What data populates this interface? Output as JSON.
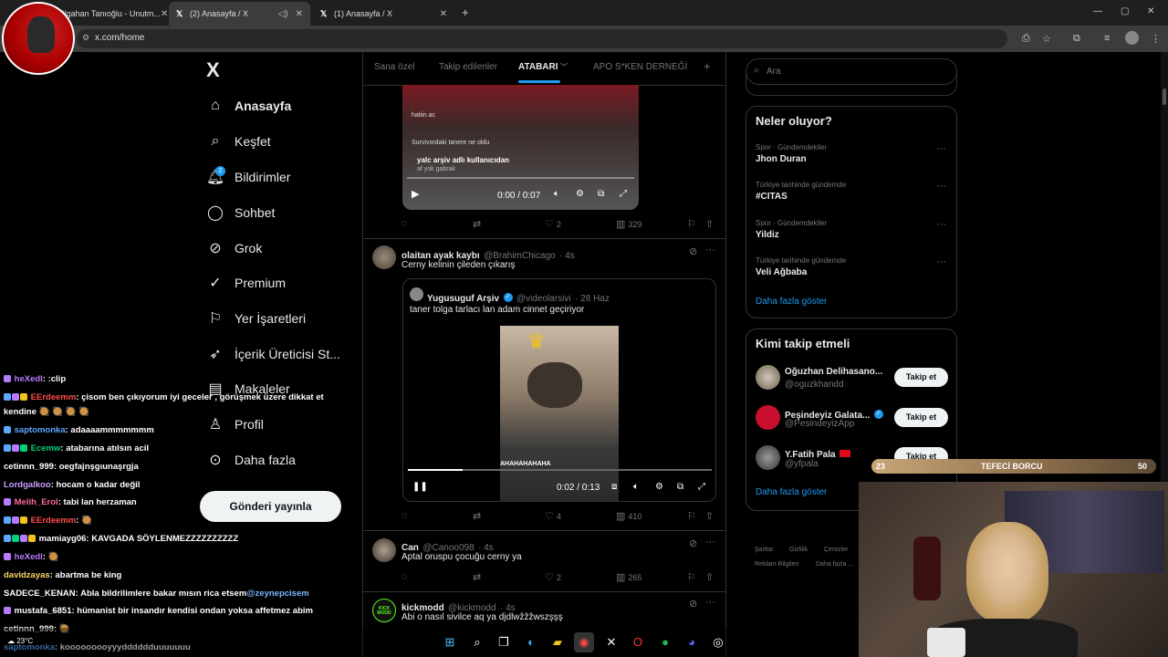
{
  "browser": {
    "tabs": [
      {
        "label": "Ilgahan Tanıoğlu - Unutm..."
      },
      {
        "label": "(2) Anasayfa / X"
      },
      {
        "label": "(1) Anasayfa / X"
      }
    ],
    "new_tab": "+",
    "url": "x.com/home"
  },
  "nav": {
    "logo": "X",
    "items": [
      {
        "label": "Anasayfa",
        "icon": "home-icon"
      },
      {
        "label": "Keşfet",
        "icon": "search-icon"
      },
      {
        "label": "Bildirimler",
        "icon": "bell-icon",
        "badge": "2"
      },
      {
        "label": "Sohbet",
        "icon": "chat-icon"
      },
      {
        "label": "Grok",
        "icon": "grok-icon"
      },
      {
        "label": "Premium",
        "icon": "premium-icon"
      },
      {
        "label": "Yer İşaretleri",
        "icon": "bookmark-icon"
      },
      {
        "label": "İçerik Üreticisi St...",
        "icon": "rocket-icon"
      },
      {
        "label": "Makaleler",
        "icon": "article-icon"
      },
      {
        "label": "Profil",
        "icon": "user-icon"
      },
      {
        "label": "Daha fazla",
        "icon": "more-icon"
      }
    ],
    "post_button": "Gönderi yayınla"
  },
  "main": {
    "tabs": [
      "Sana özel",
      "Takip edilenler",
      "ATABARI",
      "APO S*KEN DERNEĞİ"
    ],
    "add_tab": "+",
    "tweet0": {
      "video_overlay": [
        "hatiin ac",
        "Survivordaki tanere ne oldu",
        "yalc arşiv adlı kullanıcıdan",
        "af yok gabrak"
      ],
      "time": "0:00 / 0:07",
      "likes": "2",
      "views": "329"
    },
    "tweet1": {
      "name": "olaitan ayak kaybı",
      "handle": "@BrahimChicago",
      "time": "· 4s",
      "text": "Cerny kelinin çileden çıkarış",
      "quote": {
        "name": "Yugusuguf Arşiv",
        "handle": "@videolarsivi",
        "time": "· 28 Haz",
        "text": "taner tolga tarlacı lan adam cinnet geçiriyor",
        "video_time": "0:02 / 0:13",
        "video_caption": "AHAHAHAHAHA"
      },
      "likes": "4",
      "views": "410"
    },
    "tweet2": {
      "name": "Can",
      "handle": "@Canoo098",
      "time": "· 4s",
      "text": "Aptal oruspu çocuğu cerny ya",
      "likes": "2",
      "views": "265"
    },
    "tweet3": {
      "name": "kickmodd",
      "handle": "@kickmodd",
      "time": "· 4s",
      "text": "Abi o nasıl sivilce aq ya djdlwẑẑẑwszşşş",
      "avatar_text": "KICK MODD"
    }
  },
  "right": {
    "search_placeholder": "Ara",
    "trends_title": "Neler oluyor?",
    "trends": [
      {
        "category": "Spor · Gündemdekiler",
        "name": "Jhon Duran"
      },
      {
        "category": "Türkiye tarihinde gündemde",
        "name": "#CITAS"
      },
      {
        "category": "Spor · Gündemdekiler",
        "name": "Yildiz"
      },
      {
        "category": "Türkiye tarihinde gündemde",
        "name": "Veli Ağbaba"
      }
    ],
    "show_more": "Daha fazla göster",
    "follow_title": "Kimi takip etmeli",
    "follow": [
      {
        "name": "Oğuzhan Delihasano...",
        "handle": "@oguzkhandd",
        "button": "Takip et"
      },
      {
        "name": "Peşindeyiz Galata...",
        "handle": "@PesindeyizApp",
        "button": "Takip et"
      },
      {
        "name": "Y.Fatih Pala",
        "handle": "@yfpala",
        "button": "Takip et"
      }
    ],
    "follow_more": "Daha fazla göster",
    "footer": [
      "Şartlar",
      "Gizlilik",
      "Çerezler",
      "Reklam Bilgileri",
      "Daha fazla ..."
    ]
  },
  "overlay": {
    "progress_left": "23",
    "progress_title": "TEFECİ BORCU",
    "progress_right": "50",
    "weather": "23°C"
  },
  "chat": [
    {
      "user": "heXedl",
      "msg": ": :clip",
      "color": "#b77bff"
    },
    {
      "user": "EErdeemm",
      "msg": ": çisom ben çıkıyorum iyi geceler , görüşmek üzere dikkat et",
      "color": "#ff4d4d"
    },
    {
      "user": "",
      "msg": "kendine 🥘 🥘 🥘 🥘",
      "color": "#ffffff"
    },
    {
      "user": "saptomonka",
      "msg": ": adaaaammmmmmm",
      "color": "#5aa9ff"
    },
    {
      "user": "Ecemw",
      "msg": ": atabarına atılsın acil",
      "color": "#00d27a"
    },
    {
      "user": "cetinnn_999",
      "msg": ": oegfajnşgıunaşrgja",
      "color": "#ffffff"
    },
    {
      "user": "Lordgalkoo",
      "msg": ": hocam o kadar değil",
      "color": "#c9a0ff"
    },
    {
      "user": "Melih_Erol",
      "msg": ": tabi lan herzaman",
      "color": "#ff6a9e"
    },
    {
      "user": "EErdeemm",
      "msg": ": 🥘",
      "color": "#ff4d4d"
    },
    {
      "user": "mamiayg06",
      "msg": ": KAVGADA SÖYLENMEZZZZZZZZZZ",
      "color": "#ffffff"
    },
    {
      "user": "heXedl",
      "msg": ": 🥘",
      "color": "#b77bff"
    },
    {
      "user": "davidzayas",
      "msg": ": abartma be king",
      "color": "#ffd866"
    },
    {
      "user": "SADECE_KENAN",
      "msg": ": Abla bildrilimlere bakar mısın rica etsem",
      "color": "#ffffff"
    },
    {
      "user": "mustafa_6851",
      "msg": ": hümanist bir insandır kendisi ondan yoksa affetmez abim",
      "color": "#ffffff"
    },
    {
      "user": "cetinnn_999",
      "msg": ": 🥘",
      "color": "#ffffff"
    },
    {
      "user": "saptomonka",
      "msg": ": kooooooooyyydddddduuuuuuu",
      "color": "#5aa9ff"
    }
  ],
  "chat_mention": "@zeynepcisem"
}
